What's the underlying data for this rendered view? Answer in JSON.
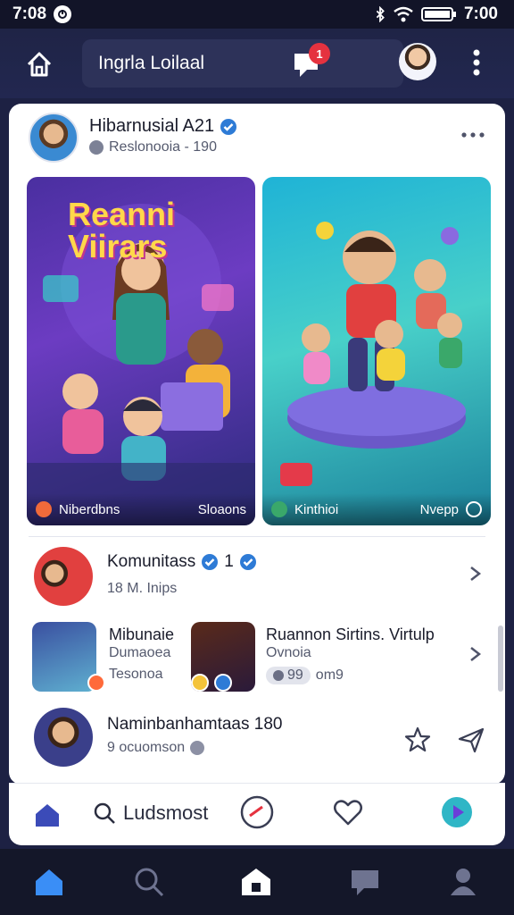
{
  "status_bar": {
    "time_left": "7:08",
    "time_right": "7:00"
  },
  "header": {
    "search_text": "Ingrla Loilaal",
    "notification_count": "1"
  },
  "post": {
    "author": "Hibarnusial A21",
    "meta": "Reslonooia - 190",
    "tiles": [
      {
        "title": "Reanni Viirars",
        "caption_left": "Niberdbns",
        "caption_right": "Sloaons"
      },
      {
        "caption_left": "Kinthioi",
        "caption_right": "Nvepp"
      }
    ]
  },
  "rows": {
    "community": {
      "title": "Komunitass",
      "count": "1",
      "sub": "18 M. Inips"
    },
    "pair": {
      "left_title": "Mibunaie",
      "left_sub": "Dumaoea",
      "left_meta": "Tesonoa",
      "right_title": "Ruannon Sirtins. Virtulp",
      "right_sub": "Ovnoia",
      "right_pill": "99",
      "right_meta": "om9"
    },
    "person": {
      "title": "Naminbanhamtaas 180",
      "sub": "9 ocuomson"
    }
  },
  "inner_nav": {
    "search_label": "Ludsmost"
  },
  "colors": {
    "accent": "#2e7bd6",
    "badge": "#e5323f",
    "nav_active": "#3a8ef6"
  }
}
